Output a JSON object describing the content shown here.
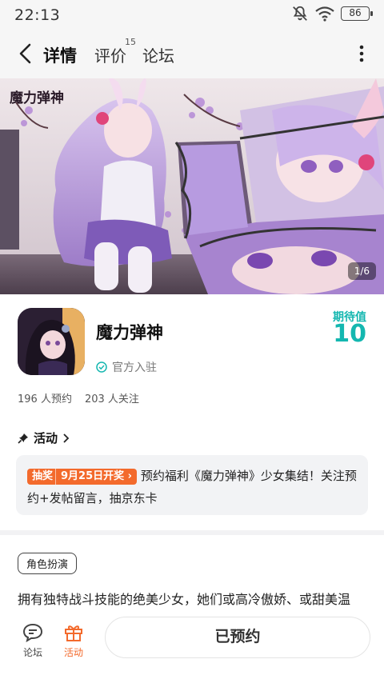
{
  "status_bar": {
    "time": "22:13",
    "battery": "86"
  },
  "nav": {
    "tabs": [
      {
        "label": "详情",
        "active": true
      },
      {
        "label": "评价",
        "count": "15"
      },
      {
        "label": "论坛"
      }
    ]
  },
  "banner": {
    "title": "魔力弹神",
    "counter": "1/6"
  },
  "app": {
    "name": "魔力弹神",
    "official": "官方入驻",
    "score_label": "期待值",
    "score_value": "10",
    "reservations": "196 人预约",
    "followers": "203 人关注"
  },
  "activity": {
    "heading": "活动",
    "tag": "抽奖",
    "date": "9月25日开奖",
    "text": "预约福利《魔力弹神》少女集结！关注预约+发帖留言，抽京东卡"
  },
  "genre": "角色扮演",
  "description": "拥有独特战斗技能的绝美少女，她们或高冷傲娇、或甜美温",
  "bottom": {
    "forum_label": "论坛",
    "activity_label": "活动",
    "reserve_button": "已预约"
  },
  "colors": {
    "accent": "#14b7b0",
    "highlight": "#f36a2c"
  }
}
